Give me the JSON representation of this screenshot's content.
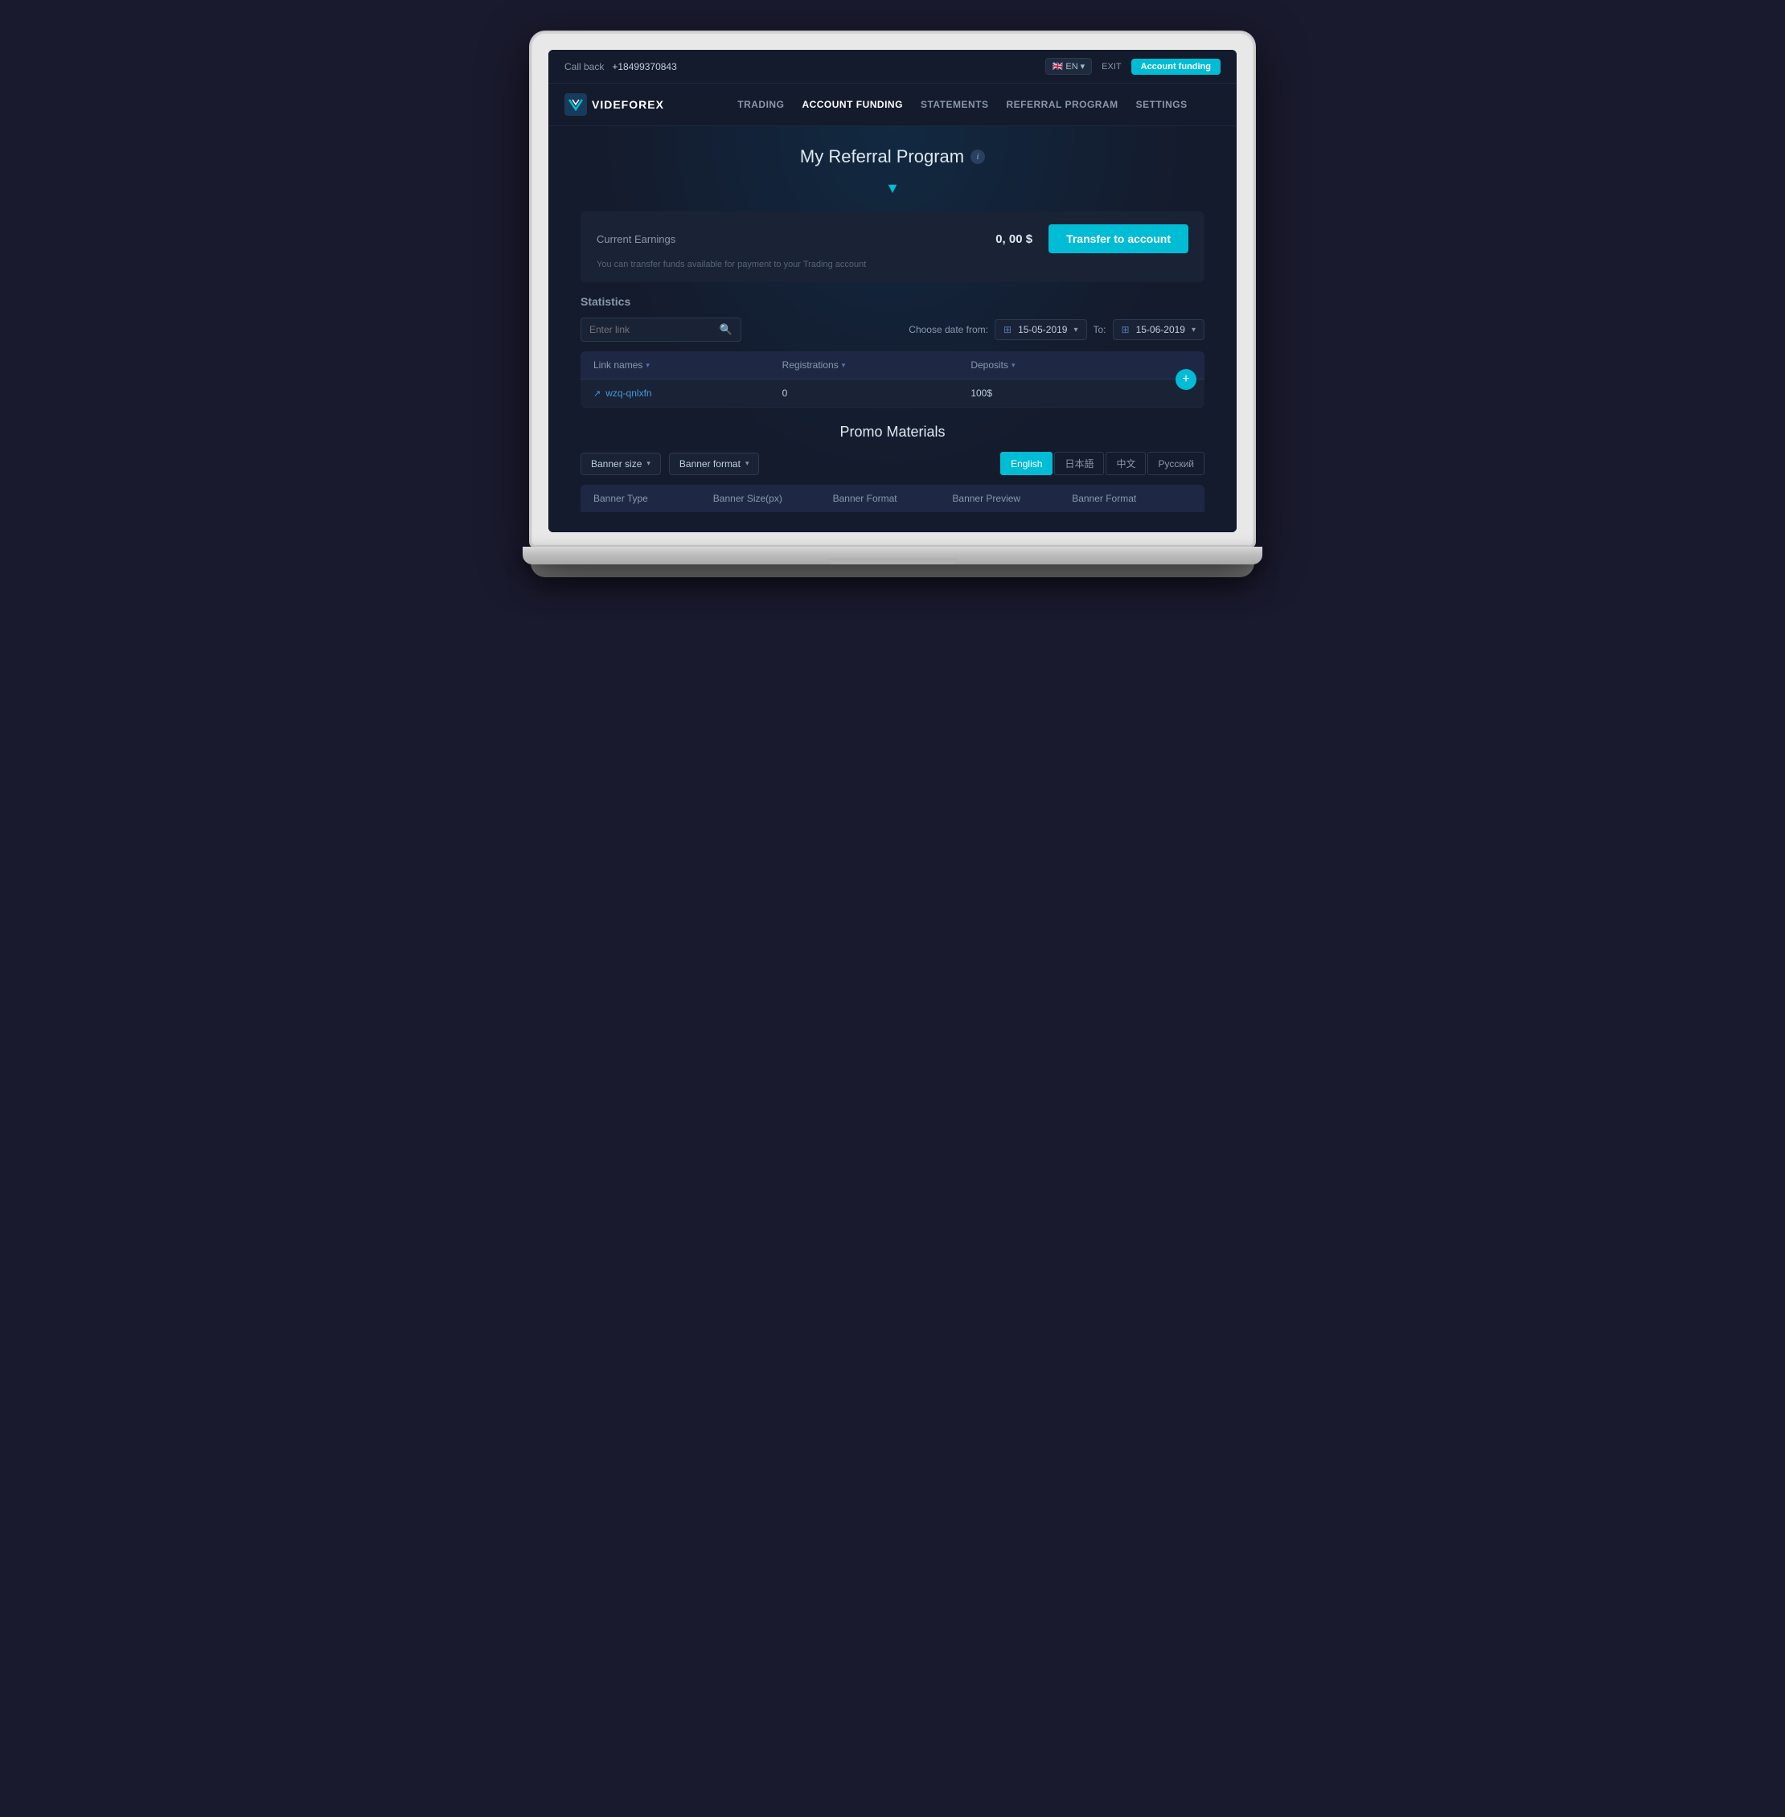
{
  "topbar": {
    "callback_label": "Call back",
    "phone": "+18499370843",
    "lang": "EN",
    "lang_arrow": "▾",
    "exit_label": "EXIT",
    "account_funding_label": "Account funding"
  },
  "navbar": {
    "logo_text": "VIDEFOREX",
    "links": [
      {
        "id": "trading",
        "label": "TRADING",
        "active": false
      },
      {
        "id": "account-funding",
        "label": "ACCOUNT FUNDING",
        "active": true
      },
      {
        "id": "statements",
        "label": "STATEMENTS",
        "active": false
      },
      {
        "id": "referral-program",
        "label": "REFERRAL PROGRAM",
        "active": false
      },
      {
        "id": "settings",
        "label": "SETTINGS",
        "active": false
      }
    ]
  },
  "page": {
    "title": "My Referral Program",
    "info_icon": "i",
    "down_arrow": "▼"
  },
  "earnings": {
    "label": "Current Earnings",
    "value": "0, 00 $",
    "transfer_btn": "Transfer to account",
    "hint": "You can transfer funds available for payment to your Trading account"
  },
  "statistics": {
    "section_label": "Statistics",
    "search_placeholder": "Enter link",
    "date_from_label": "Choose date from:",
    "date_from_icon": "⊞",
    "date_from_value": "15-05-2019",
    "date_to_label": "To:",
    "date_to_icon": "⊞",
    "date_to_value": "15-06-2019",
    "table": {
      "headers": [
        {
          "id": "link-names",
          "label": "Link names",
          "sortable": true
        },
        {
          "id": "registrations",
          "label": "Registrations",
          "sortable": true
        },
        {
          "id": "deposits",
          "label": "Deposits",
          "sortable": true
        }
      ],
      "rows": [
        {
          "link": "wzq-qnlxfn",
          "registrations": "0",
          "deposits": "100$"
        }
      ]
    }
  },
  "promo": {
    "title": "Promo Materials",
    "filters": [
      {
        "id": "banner-size",
        "label": "Banner size"
      },
      {
        "id": "banner-format",
        "label": "Banner format"
      }
    ],
    "lang_tabs": [
      {
        "id": "english",
        "label": "English",
        "active": true
      },
      {
        "id": "japanese",
        "label": "日本語",
        "active": false
      },
      {
        "id": "chinese",
        "label": "中文",
        "active": false
      },
      {
        "id": "russian",
        "label": "Русский",
        "active": false
      }
    ],
    "table_headers": [
      "Banner Type",
      "Banner Size(px)",
      "Banner Format",
      "Banner Preview",
      "Banner Format"
    ]
  }
}
